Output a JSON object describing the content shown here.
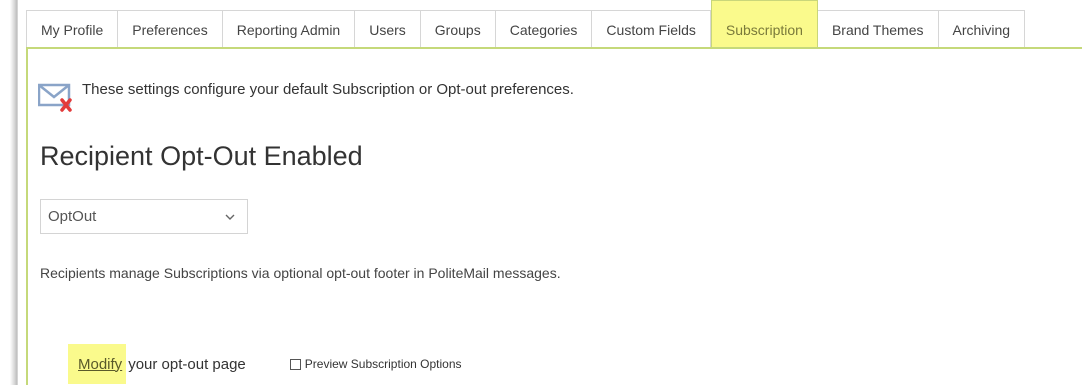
{
  "tabs": [
    {
      "label": "My Profile",
      "active": false
    },
    {
      "label": "Preferences",
      "active": false
    },
    {
      "label": "Reporting Admin",
      "active": false
    },
    {
      "label": "Users",
      "active": false
    },
    {
      "label": "Groups",
      "active": false
    },
    {
      "label": "Categories",
      "active": false
    },
    {
      "label": "Custom Fields",
      "active": false
    },
    {
      "label": "Subscription",
      "active": true
    },
    {
      "label": "Brand Themes",
      "active": false
    },
    {
      "label": "Archiving",
      "active": false
    }
  ],
  "notice": {
    "icon": "mail-error-icon",
    "text": "These settings configure your default Subscription or Opt-out preferences."
  },
  "heading": "Recipient Opt-Out Enabled",
  "select": {
    "value": "OptOut",
    "icon": "chevron-down-icon"
  },
  "description": "Recipients manage Subscriptions via optional opt-out footer in PoliteMail messages.",
  "modify": {
    "link_label": "Modify",
    "rest_label": "your opt-out page"
  },
  "preview_checkbox": {
    "label": "Preview Subscription Options",
    "checked": false
  },
  "colors": {
    "highlight": "#fafa8c",
    "panel_border": "#c5d97a",
    "tab_border": "#d6d6d6"
  }
}
